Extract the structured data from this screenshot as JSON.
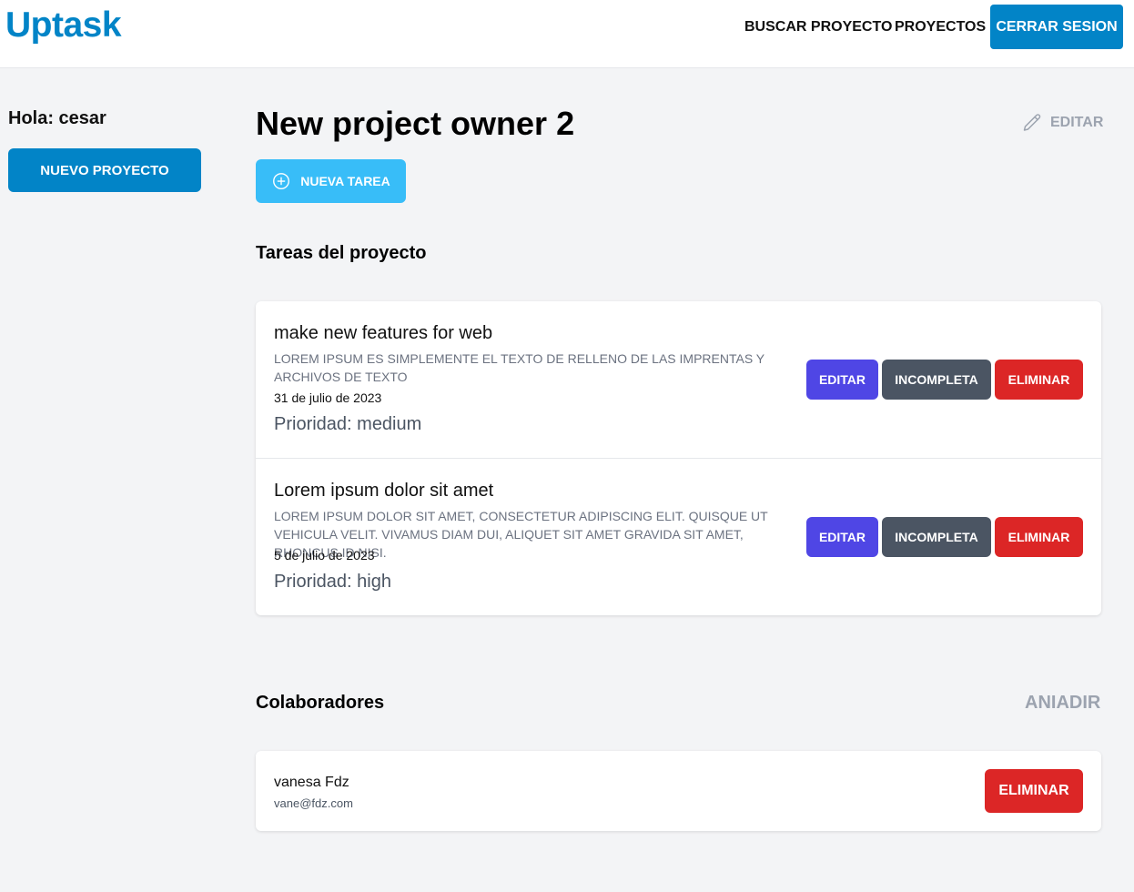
{
  "header": {
    "logo": "Uptask",
    "nav": [
      "BUSCAR PROYECTO",
      "PROYECTOS"
    ],
    "logout_label": "CERRAR SESION"
  },
  "sidebar": {
    "greeting": "Hola: cesar",
    "new_project_label": "NUEVO PROYECTO"
  },
  "project": {
    "title": "New project owner 2",
    "edit_label": "EDITAR",
    "new_task_label": "NUEVA TAREA"
  },
  "tasks_section": {
    "title": "Tareas del proyecto",
    "tasks": [
      {
        "name": "make new features for web",
        "description": "LOREM IPSUM ES SIMPLEMENTE EL TEXTO DE RELLENO DE LAS IMPRENTAS Y ARCHIVOS DE TEXTO",
        "date": "31 de julio de 2023",
        "priority": "Prioridad: medium",
        "edit_label": "EDITAR",
        "status_label": "INCOMPLETA",
        "delete_label": "ELIMINAR"
      },
      {
        "name": "Lorem ipsum dolor sit amet",
        "description": "LOREM IPSUM DOLOR SIT AMET, CONSECTETUR ADIPISCING ELIT. QUISQUE UT VEHICULA VELIT. VIVAMUS DIAM DUI, ALIQUET SIT AMET GRAVIDA SIT AMET, RHONCUS ID NISI.",
        "date": "5 de julio de 2023",
        "priority": "Prioridad: high",
        "edit_label": "EDITAR",
        "status_label": "INCOMPLETA",
        "delete_label": "ELIMINAR"
      }
    ]
  },
  "collaborators_section": {
    "title": "Colaboradores",
    "add_label": "ANIADIR",
    "collaborators": [
      {
        "name": "vanesa Fdz",
        "email": "vane@fdz.com",
        "delete_label": "ELIMINAR"
      }
    ]
  },
  "colors": {
    "brand": "#0284c7",
    "new_task": "#38bdf8",
    "edit": "#4f46e5",
    "incomplete": "#4b5563",
    "delete": "#dc2626",
    "muted": "#9ca3af"
  },
  "icons": {
    "edit_project": "pencil-icon",
    "new_task": "plus-circle-icon"
  }
}
